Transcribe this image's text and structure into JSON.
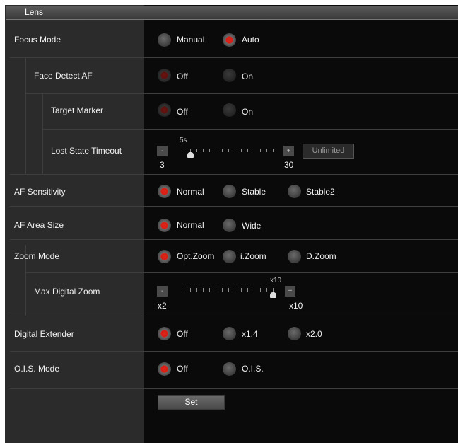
{
  "section_title": "Lens",
  "focus_mode": {
    "label": "Focus Mode",
    "options": [
      "Manual",
      "Auto"
    ],
    "selected": "Auto"
  },
  "face_detect_af": {
    "label": "Face Detect AF",
    "options": [
      "Off",
      "On"
    ],
    "selected": "Off"
  },
  "target_marker": {
    "label": "Target Marker",
    "options": [
      "Off",
      "On"
    ],
    "selected": "Off"
  },
  "lost_state_timeout": {
    "label": "Lost State Timeout",
    "minus": "-",
    "plus": "+",
    "value_label": "5s",
    "min_label": "3",
    "max_label": "30",
    "value": 5,
    "min": 3,
    "max": 30,
    "unlimited_label": "Unlimited"
  },
  "af_sensitivity": {
    "label": "AF Sensitivity",
    "options": [
      "Normal",
      "Stable",
      "Stable2"
    ],
    "selected": "Normal"
  },
  "af_area_size": {
    "label": "AF Area Size",
    "options": [
      "Normal",
      "Wide"
    ],
    "selected": "Normal"
  },
  "zoom_mode": {
    "label": "Zoom Mode",
    "options": [
      "Opt.Zoom",
      "i.Zoom",
      "D.Zoom"
    ],
    "selected": "Opt.Zoom"
  },
  "max_digital_zoom": {
    "label": "Max Digital Zoom",
    "minus": "-",
    "plus": "+",
    "value_label": "x10",
    "min_label": "x2",
    "max_label": "x10",
    "value": 10,
    "min": 2,
    "max": 10
  },
  "digital_extender": {
    "label": "Digital Extender",
    "options": [
      "Off",
      "x1.4",
      "x2.0"
    ],
    "selected": "Off"
  },
  "ois_mode": {
    "label": "O.I.S. Mode",
    "options": [
      "Off",
      "O.I.S."
    ],
    "selected": "Off"
  },
  "set_button": "Set",
  "colors": {
    "accent_red": "#d41f14",
    "panel_bg": "#0a0a0a",
    "label_col_bg": "#2b2b2b"
  }
}
